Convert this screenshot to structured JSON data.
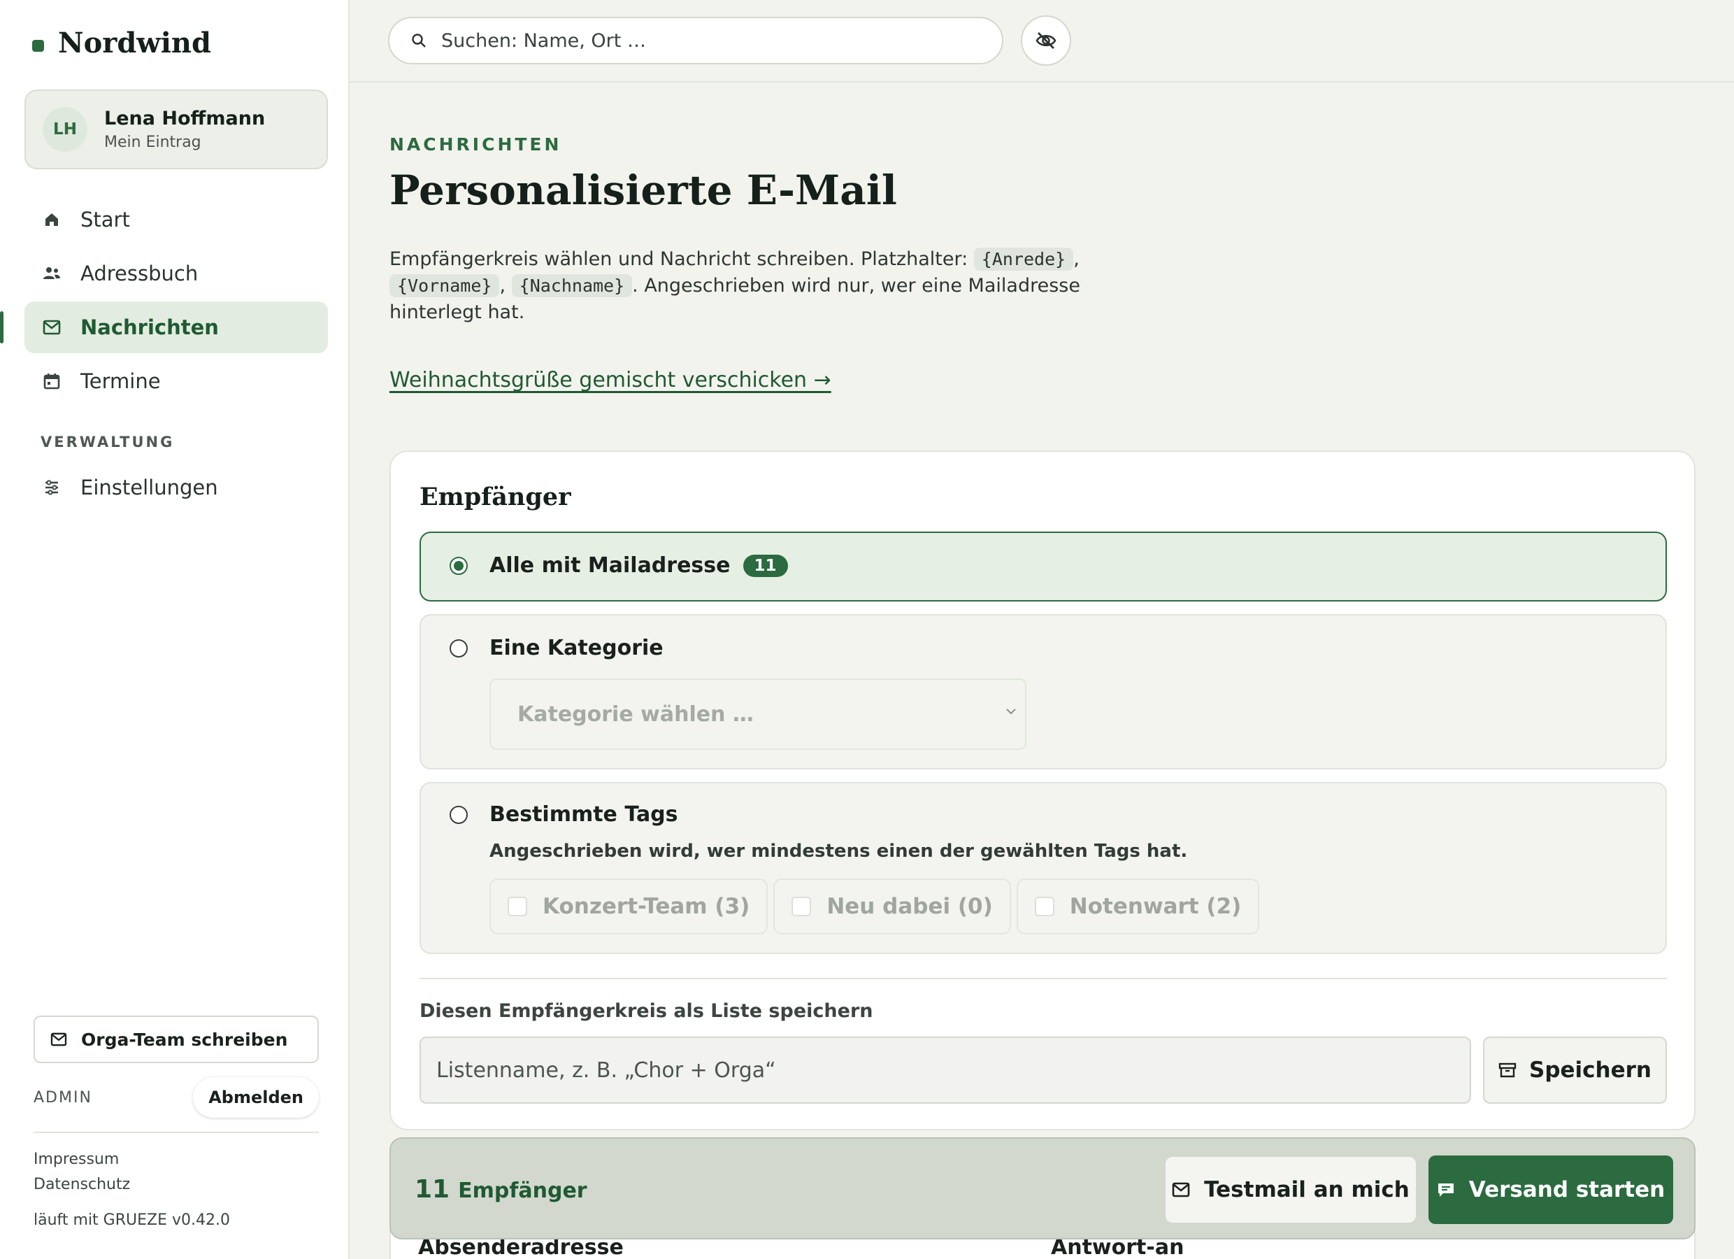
{
  "brand": {
    "name": "Nordwind",
    "accent": "#2b6b3f"
  },
  "user": {
    "initials": "LH",
    "name": "Lena Hoffmann",
    "subtitle": "Mein Eintrag"
  },
  "nav": {
    "items": [
      {
        "label": "Start",
        "icon": "home-icon"
      },
      {
        "label": "Adressbuch",
        "icon": "users-icon"
      },
      {
        "label": "Nachrichten",
        "icon": "mail-icon",
        "active": true
      },
      {
        "label": "Termine",
        "icon": "calendar-icon"
      }
    ],
    "section": "VERWALTUNG",
    "admin_items": [
      {
        "label": "Einstellungen",
        "icon": "sliders-icon"
      }
    ]
  },
  "sidebar_bottom": {
    "orga_button": "Orga-Team schreiben",
    "role": "ADMIN",
    "logout": "Abmelden",
    "imprint": "Impressum",
    "privacy": "Datenschutz",
    "version": "läuft mit GRUEZE v0.42.0"
  },
  "topbar": {
    "search_placeholder": "Suchen: Name, Ort …"
  },
  "page": {
    "eyebrow": "NACHRICHTEN",
    "title": "Personalisierte E-Mail",
    "intro_1": "Empfängerkreis wählen und Nachricht schreiben. Platzhalter:",
    "ph_anrede": "{Anrede}",
    "ph_vorname": "{Vorname}",
    "ph_nachname": "{Nachname}",
    "intro_2": ". Angeschrieben wird nur, wer eine Mailadresse hinterlegt hat.",
    "link": "Weihnachtsgrüße gemischt verschicken →"
  },
  "recipients": {
    "title": "Empfänger",
    "opt_all": {
      "label": "Alle mit Mailadresse",
      "count": "11"
    },
    "opt_category": {
      "label": "Eine Kategorie",
      "placeholder": "Kategorie wählen …"
    },
    "opt_tags": {
      "label": "Bestimmte Tags",
      "hint": "Angeschrieben wird, wer mindestens einen der gewählten Tags hat.",
      "tags": [
        "Konzert-Team (3)",
        "Neu dabei (0)",
        "Notenwart (2)"
      ]
    },
    "save_list_label": "Diesen Empfängerkreis als Liste speichern",
    "list_placeholder": "Listenname, z. B. „Chor + Orga“",
    "save_button": "Speichern"
  },
  "action_bar": {
    "count": "11",
    "count_label": "Empfänger",
    "test_button": "Testmail an mich",
    "send_button": "Versand starten"
  },
  "below": {
    "sender": "Absenderadresse",
    "reply_to": "Antwort-an"
  }
}
